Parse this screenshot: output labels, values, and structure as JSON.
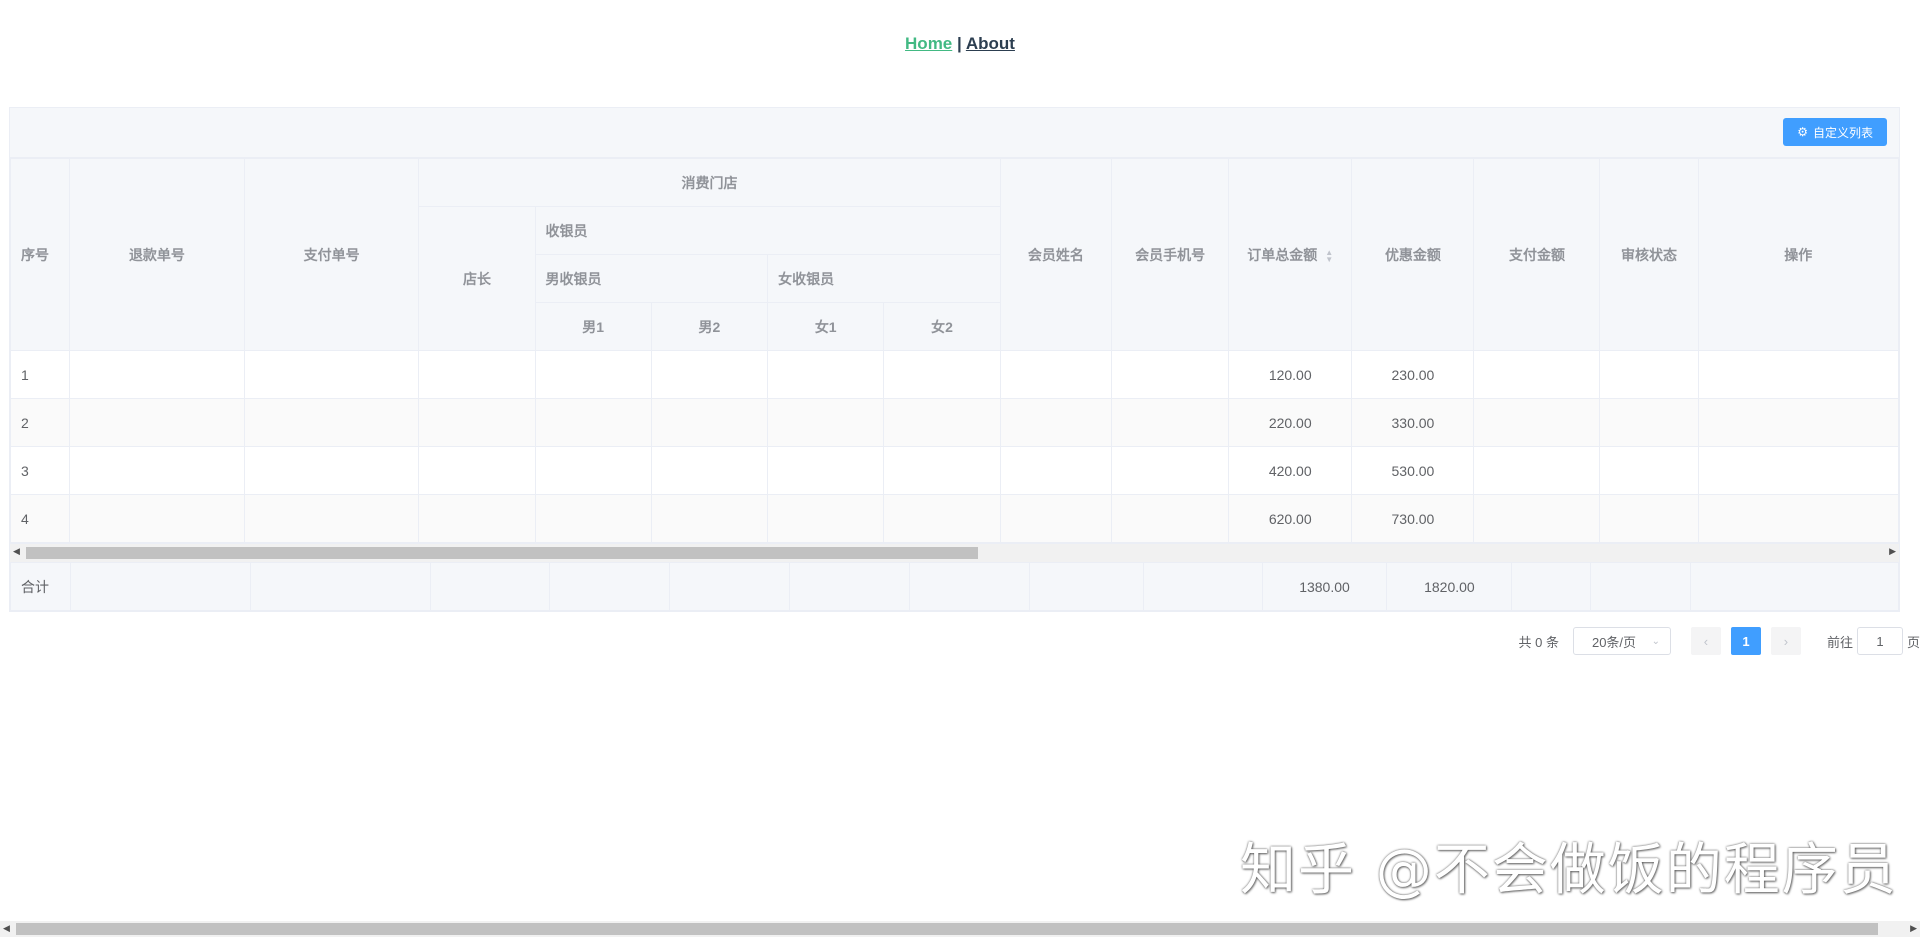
{
  "nav": {
    "home": "Home",
    "sep": "|",
    "about": "About"
  },
  "toolbar": {
    "custom_button": "自定义列表",
    "icon": "gear-icon"
  },
  "table": {
    "headers": {
      "index": "序号",
      "refund_no": "退款单号",
      "pay_no": "支付单号",
      "store": "消费门店",
      "manager": "店长",
      "cashier": "收银员",
      "male_cashier": "男收银员",
      "female_cashier": "女收银员",
      "m1": "男1",
      "m2": "男2",
      "f1": "女1",
      "f2": "女2",
      "member_name": "会员姓名",
      "member_phone": "会员手机号",
      "order_total": "订单总金额",
      "discount": "优惠金额",
      "pay_amount": "支付金额",
      "audit": "审核状态",
      "actions": "操作"
    },
    "rows": [
      {
        "index": "1",
        "order_total": "120.00",
        "discount": "230.00"
      },
      {
        "index": "2",
        "order_total": "220.00",
        "discount": "330.00"
      },
      {
        "index": "3",
        "order_total": "420.00",
        "discount": "530.00"
      },
      {
        "index": "4",
        "order_total": "620.00",
        "discount": "730.00"
      }
    ],
    "summary": {
      "label": "合计",
      "order_total": "1380.00",
      "discount": "1820.00"
    }
  },
  "pagination": {
    "total": "共 0 条",
    "page_size": "20条/页",
    "current": "1",
    "goto_label": "前往",
    "goto_value": "1",
    "page_unit": "页"
  },
  "watermark": "知乎 @不会做饭的程序员",
  "colors": {
    "primary": "#409eff",
    "link_active": "#42b983"
  }
}
